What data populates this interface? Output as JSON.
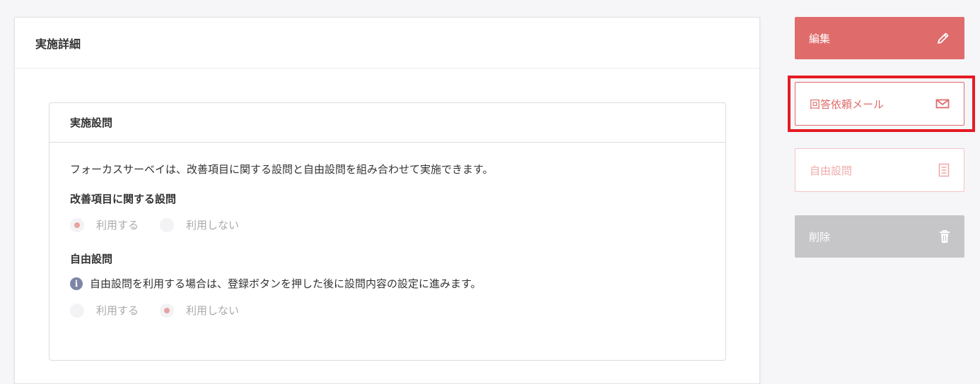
{
  "main": {
    "title": "実施詳細",
    "questions_card": {
      "title": "実施設問",
      "description": "フォーカスサーベイは、改善項目に関する設問と自由設問を組み合わせて実施できます。",
      "improvement_section": {
        "title": "改善項目に関する設問",
        "options": [
          {
            "label": "利用する",
            "selected": true
          },
          {
            "label": "利用しない",
            "selected": false
          }
        ]
      },
      "free_section": {
        "title": "自由設問",
        "info": "自由設問を利用する場合は、登録ボタンを押した後に設問内容の設定に進みます。",
        "options": [
          {
            "label": "利用する",
            "selected": false
          },
          {
            "label": "利用しない",
            "selected": true
          }
        ]
      }
    }
  },
  "sidebar": {
    "edit_label": "編集",
    "mail_label": "回答依頼メール",
    "free_label": "自由設問",
    "delete_label": "削除"
  },
  "colors": {
    "accent": "#e06b6b",
    "highlight": "#e41b23",
    "disabled": "#c6c6c9"
  },
  "icons": {
    "edit": "pencil-icon",
    "mail": "envelope-icon",
    "free": "document-icon",
    "delete": "trash-icon",
    "info": "info-icon"
  }
}
